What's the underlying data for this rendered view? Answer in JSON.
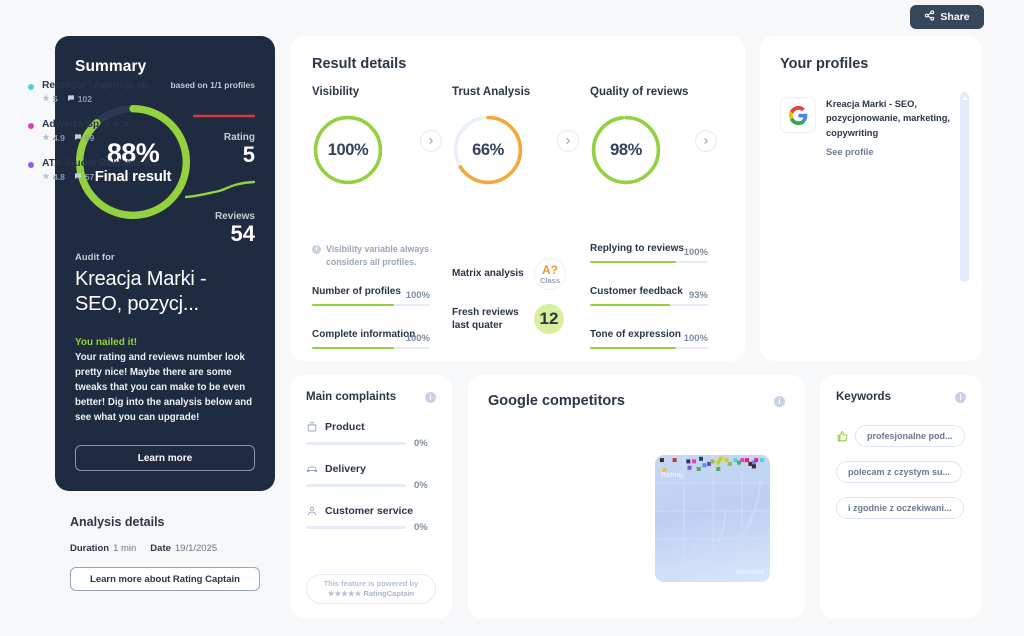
{
  "topbar": {
    "share_label": "Share",
    "share_icon": "share-icon"
  },
  "summary": {
    "title": "Summary",
    "basis": "based on 1/1 profiles",
    "final_percent": "88%",
    "final_label": "Final result",
    "final_value": 88,
    "rating_label": "Rating",
    "rating_value": "5",
    "reviews_label": "Reviews",
    "reviews_value": "54",
    "audit_for_label": "Audit for",
    "audit_name": "Kreacja Marki - SEO, pozycj...",
    "nailed_title": "You nailed it!",
    "nailed_body": "Your rating and reviews number look pretty nice! Maybe there are some tweaks that you can make to be even better! Dig into the analysis below and see what you can upgrade!",
    "learn_more_label": "Learn more",
    "accent_green": "#93d13f",
    "rating_line_color": "#d93a3a",
    "bg": "#1e2b40"
  },
  "analysis": {
    "title": "Analysis details",
    "duration_label": "Duration",
    "duration_value": "1 min",
    "date_label": "Date",
    "date_value": "19/1/2025",
    "button_label": "Learn more about Rating Captain"
  },
  "result_details": {
    "title": "Result details",
    "metrics": [
      {
        "name": "Visibility",
        "value": "100%",
        "pct": 100,
        "color": "#93d13f"
      },
      {
        "name": "Trust Analysis",
        "value": "66%",
        "pct": 66,
        "color": "#f5a93c"
      },
      {
        "name": "Quality of reviews",
        "value": "98%",
        "pct": 98,
        "color": "#93d13f"
      }
    ],
    "visibility_note": "Visibility variable always considers all profiles.",
    "visibility_bars": [
      {
        "label": "Number of profiles",
        "pct": "100%",
        "value": 100
      },
      {
        "label": "Complete information",
        "pct": "100%",
        "value": 100
      }
    ],
    "trust_stats": [
      {
        "label": "Matrix analysis",
        "badge_main": "A?",
        "badge_sub": "Class"
      },
      {
        "label": "Fresh reviews last quater",
        "number": "12"
      }
    ],
    "quality_bars": [
      {
        "label": "Replying to reviews",
        "pct": "100%",
        "value": 100
      },
      {
        "label": "Customer feedback",
        "pct": "93%",
        "value": 93
      },
      {
        "label": "Tone of expression",
        "pct": "100%",
        "value": 100
      }
    ]
  },
  "profiles": {
    "title": "Your profiles",
    "items": [
      {
        "logo": "google-icon",
        "name": "Kreacja Marki - SEO, pozycjonowanie, marketing, copywriting",
        "link_label": "See profile"
      }
    ]
  },
  "complaints": {
    "title": "Main complaints",
    "info_icon": "info-icon",
    "items": [
      {
        "icon": "shopping-bag-icon",
        "label": "Product",
        "pct": "0%",
        "value": 0
      },
      {
        "icon": "car-icon",
        "label": "Delivery",
        "pct": "0%",
        "value": 0
      },
      {
        "icon": "user-icon",
        "label": "Customer service",
        "pct": "0%",
        "value": 0
      }
    ],
    "powered_line1": "This feature is powered by",
    "powered_line2": "RatingCaptain"
  },
  "competitors": {
    "title": "Google competitors",
    "info_icon": "info-icon",
    "items": [
      {
        "name": "Recreate | Agencja M...",
        "rating": "5",
        "reviews": "102",
        "color": "#4ad4e0"
      },
      {
        "name": "Adwerto Sp. z o.o.",
        "rating": "4.9",
        "reviews": "69",
        "color": "#e040c0"
      },
      {
        "name": "ATA Studio Reklamy B...",
        "rating": "4.8",
        "reviews": "57",
        "color": "#8b5cf6"
      }
    ],
    "chart_data": {
      "type": "scatter",
      "title": "Google competitors",
      "xlabel": "Reviews",
      "ylabel": "Rating",
      "grid": true,
      "points": [
        {
          "x": 6,
          "y": 96,
          "color": "#3b2d1f"
        },
        {
          "x": 17,
          "y": 96,
          "color": "#c0392b"
        },
        {
          "x": 29,
          "y": 95,
          "color": "#3a2f5f"
        },
        {
          "x": 34,
          "y": 95,
          "color": "#e040c0"
        },
        {
          "x": 40,
          "y": 97,
          "color": "#2f3a66"
        },
        {
          "x": 47,
          "y": 93,
          "color": "#6f42c1"
        },
        {
          "x": 50,
          "y": 95,
          "color": "#8bc34a"
        },
        {
          "x": 55,
          "y": 94,
          "color": "#c8d400"
        },
        {
          "x": 57,
          "y": 97,
          "color": "#c8d400"
        },
        {
          "x": 62,
          "y": 96,
          "color": "#f0c419"
        },
        {
          "x": 65,
          "y": 93,
          "color": "#8bc34a"
        },
        {
          "x": 70,
          "y": 96,
          "color": "#4ad4e0"
        },
        {
          "x": 73,
          "y": 94,
          "color": "#4caf50"
        },
        {
          "x": 76,
          "y": 96,
          "color": "#e040c0"
        },
        {
          "x": 80,
          "y": 96,
          "color": "#e91e8c"
        },
        {
          "x": 83,
          "y": 93,
          "color": "#3b2d1f"
        },
        {
          "x": 86,
          "y": 94,
          "color": "#5b8def"
        },
        {
          "x": 88,
          "y": 96,
          "color": "#e91e8c"
        },
        {
          "x": 93,
          "y": 96,
          "color": "#4ad4e0"
        },
        {
          "x": 30,
          "y": 90,
          "color": "#7e57c2"
        },
        {
          "x": 38,
          "y": 89,
          "color": "#4caf50"
        },
        {
          "x": 55,
          "y": 89,
          "color": "#4caf50"
        },
        {
          "x": 8,
          "y": 88,
          "color": "#f0c419"
        },
        {
          "x": 43,
          "y": 92,
          "color": "#5b8def"
        },
        {
          "x": 86,
          "y": 91,
          "color": "#3b2d1f"
        }
      ],
      "xlim": [
        0,
        100
      ],
      "ylim": [
        0,
        100
      ]
    }
  },
  "keywords": {
    "title": "Keywords",
    "info_icon": "info-icon",
    "items": [
      {
        "label": "profesjonalne pod...",
        "thumb": true
      },
      {
        "label": "polecam z czystym su...",
        "thumb": false
      },
      {
        "label": "i zgodnie z oczekiwani...",
        "thumb": false
      }
    ]
  }
}
